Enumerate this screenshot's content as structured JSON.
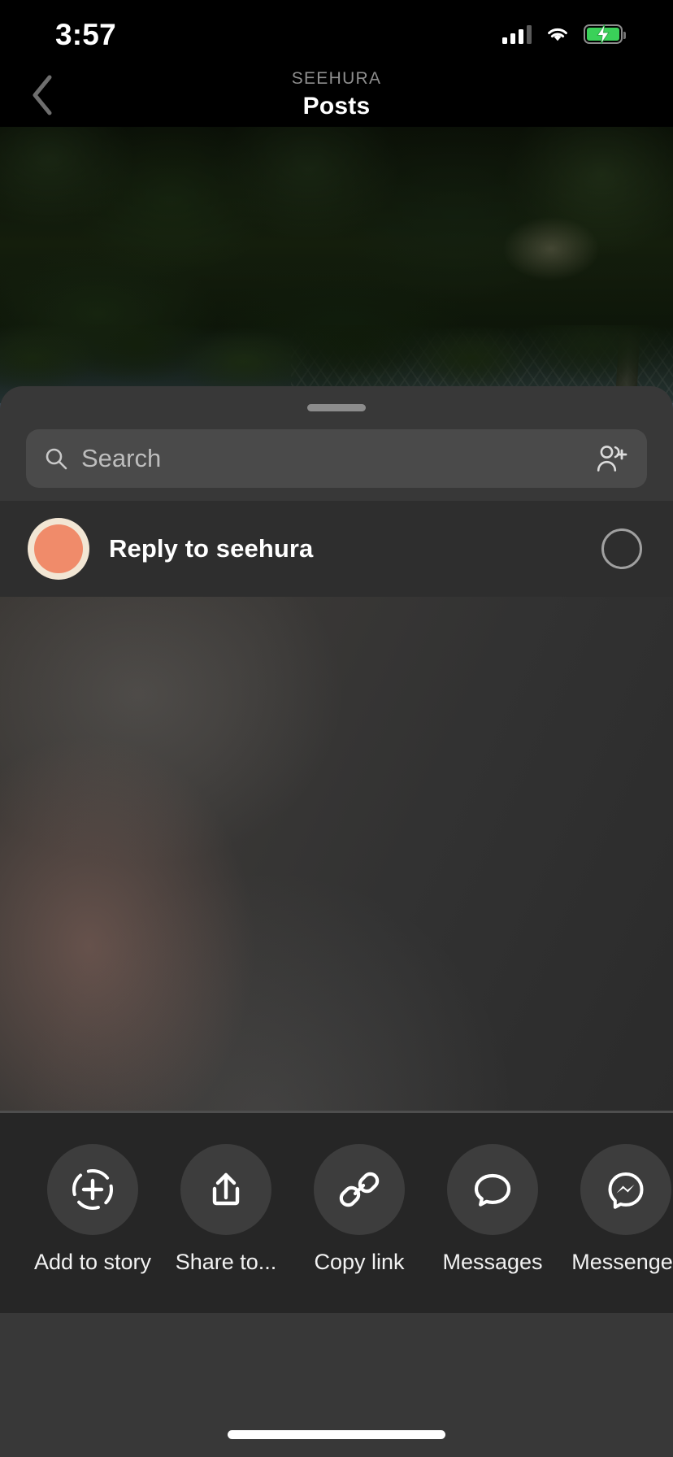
{
  "status_bar": {
    "time": "3:57",
    "signal_icon": "cellular-signal-icon",
    "wifi_icon": "wifi-icon",
    "battery_icon": "battery-charging-icon",
    "battery_charging": true
  },
  "nav": {
    "back_icon": "chevron-left-icon",
    "eyebrow": "SEEHURA",
    "title": "Posts"
  },
  "background": {
    "description": "grapevine-canopy-photo"
  },
  "share_sheet": {
    "grabber": "drag-handle",
    "search": {
      "placeholder": "Search",
      "value": "",
      "search_icon": "search-icon",
      "add_people_icon": "add-people-icon"
    },
    "reply_row": {
      "label": "Reply to seehura",
      "avatar_icon": "user-avatar",
      "avatar_ring_color": "#f2e6d4",
      "avatar_color": "#f08b6a",
      "selected": false,
      "select_icon": "selection-circle-icon"
    },
    "actions": [
      {
        "label": "Add to story",
        "icon": "add-to-story-icon"
      },
      {
        "label": "Share to...",
        "icon": "share-out-icon"
      },
      {
        "label": "Copy link",
        "icon": "link-icon"
      },
      {
        "label": "Messages",
        "icon": "message-bubble-icon"
      },
      {
        "label": "Messenger",
        "icon": "messenger-icon"
      }
    ]
  },
  "home_indicator": "home-indicator",
  "colors": {
    "sheet_bg": "#383838",
    "search_bg": "#4a4a4a",
    "action_bg": "#262626",
    "accent_green": "#3ad159",
    "text_primary": "#ffffff",
    "text_secondary": "#8e8e8e"
  }
}
